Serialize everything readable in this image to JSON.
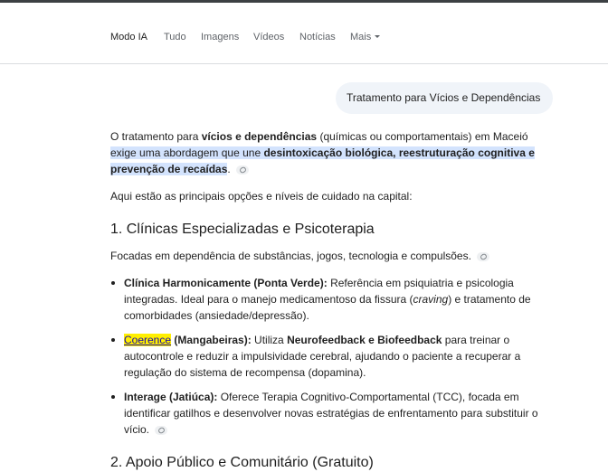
{
  "tabs": [
    {
      "label": "Modo IA"
    },
    {
      "label": "Tudo"
    },
    {
      "label": "Imagens"
    },
    {
      "label": "Vídeos"
    },
    {
      "label": "Notícias"
    },
    {
      "label": "Mais"
    }
  ],
  "query": "Tratamento para Vícios e Dependências",
  "intro": {
    "t1": "O tratamento para ",
    "b1": "vícios e dependências",
    "t2": " (químicas ou comportamentais) em Maceió ",
    "h1": "exige uma abordagem que une ",
    "hb1": "desintoxicação biológica, reestruturação cognitiva e prevenção de recaídas",
    "t3": "."
  },
  "options_line": "Aqui estão as principais opções e níveis de cuidado na capital:",
  "section1": {
    "heading": "1. Clínicas Especializadas e Psicoterapia",
    "lead": "Focadas em dependência de substâncias, jogos, tecnologia e compulsões.",
    "items": [
      {
        "name": "Clínica Harmonicamente (Ponta Verde):",
        "text1": " Referência em psiquiatria e psicologia integradas. Ideal para o manejo medicamentoso da fissura (",
        "italic": "craving",
        "text2": ") e tratamento de comorbidades (ansiedade/depressão)."
      },
      {
        "link": "Coerence",
        "name": " (Mangabeiras):",
        "text1": " Utiliza ",
        "bold2": "Neurofeedback e Biofeedback",
        "text2": " para treinar o autocontrole e reduzir a impulsividade cerebral, ajudando o paciente a recuperar a regulação do sistema de recompensa (dopamina)."
      },
      {
        "name": "Interage (Jatiúca):",
        "text1": " Oferece Terapia Cognitivo-Comportamental (TCC), focada em identificar gatilhos e desenvolver novas estratégias de enfrentamento para substituir o vício."
      }
    ]
  },
  "section2_heading": "2. Apoio Público e Comunitário (Gratuito)"
}
